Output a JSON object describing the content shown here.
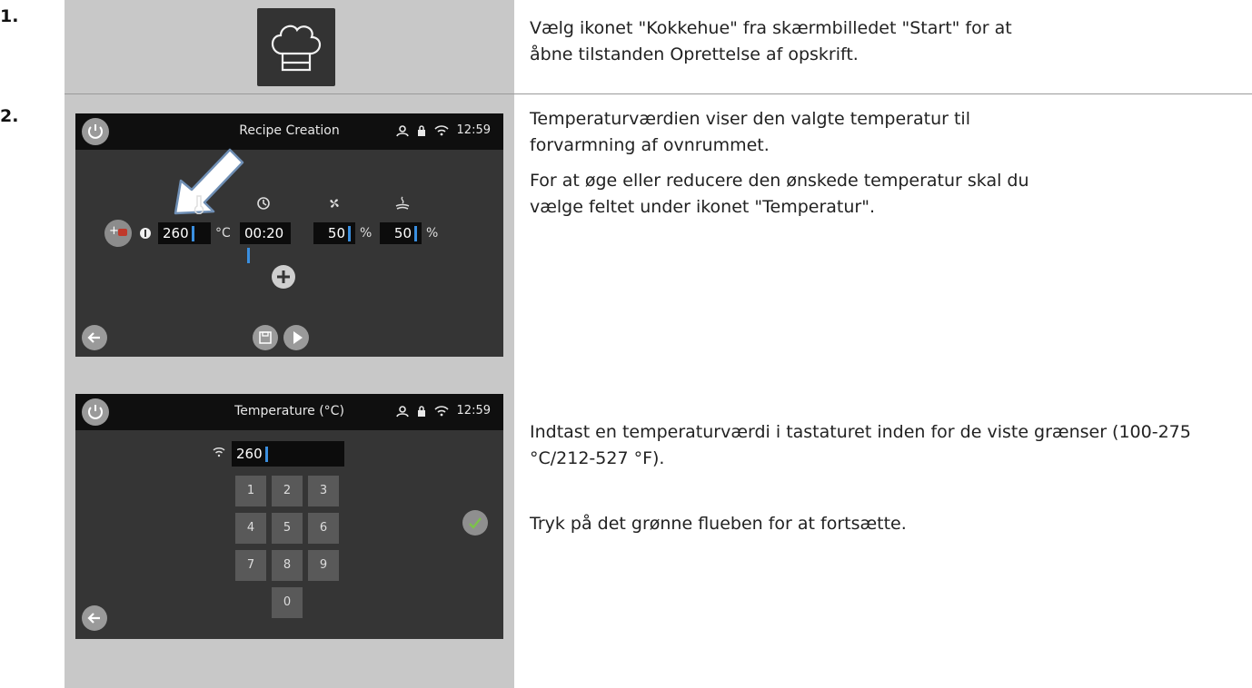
{
  "steps": [
    {
      "number": "1.",
      "text": "Vælg ikonet \"Kokkehue\" fra skærmbilledet \"Start\" for at åbne tilstanden Oprettelse af opskrift."
    },
    {
      "number": "2.",
      "text_a1": "Temperaturværdien viser den valgte temperatur til forvarmning af ovnrummet.",
      "text_a2": "For at øge eller reducere den ønskede temperatur skal du vælge feltet under ikonet \"Temperatur\".",
      "text_b1": "Indtast en temperaturværdi i tastaturet inden for de viste grænser (100-275 °C/212-527 °F).",
      "text_b2": "Tryk på det grønne flueben for at fortsætte."
    }
  ],
  "screen1": {
    "title": "Recipe Creation",
    "time": "12:59",
    "add_phase_label": "+",
    "temperature": "260",
    "temperature_unit": "°C",
    "time_value": "00:20",
    "fan": "50",
    "fan_unit": "%",
    "humidity": "50",
    "humidity_unit": "%",
    "icons": {
      "power": "power-icon",
      "user": "user-icon",
      "lock": "lock-icon",
      "wifi": "wifi-icon",
      "thermometer": "thermometer-icon",
      "clock": "clock-icon",
      "fan": "fan-icon",
      "steam": "steam-icon",
      "add": "plus-icon",
      "save": "save-icon",
      "play": "play-icon",
      "back": "back-arrow-icon",
      "pointer": "arrow-pointer-icon"
    }
  },
  "screen2": {
    "title": "Temperature (°C)",
    "time": "12:59",
    "input_value": "260",
    "keys": [
      "1",
      "2",
      "3",
      "4",
      "5",
      "6",
      "7",
      "8",
      "9",
      "0"
    ],
    "confirm_icon": "checkmark-icon",
    "accent_confirm": "#7cc24a"
  },
  "colors": {
    "screen_bg": "#353535",
    "status_bar": "#0f0f0f",
    "image_panel": "#c8c8c8",
    "cursor": "#3a8fe0"
  }
}
